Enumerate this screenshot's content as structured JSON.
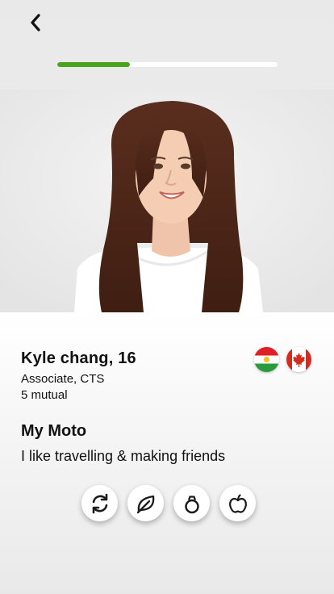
{
  "navigation": {
    "back_icon": "chevron-left-icon"
  },
  "progress": {
    "value": 0.33,
    "fill_color": "#4aa31a",
    "track_color": "#ffffff"
  },
  "profile": {
    "photo_alt": "Profile photo",
    "name_age": "Kyle chang, 16",
    "role": "Associate, CTS",
    "mutual": "5 mutual",
    "flags": [
      "kurdistan-flag-icon",
      "canada-flag-icon"
    ]
  },
  "moto": {
    "title": "My Moto",
    "text": "I like travelling & making friends"
  },
  "interests": [
    "refresh-icon",
    "leaf-icon",
    "ring-icon",
    "apple-icon"
  ]
}
